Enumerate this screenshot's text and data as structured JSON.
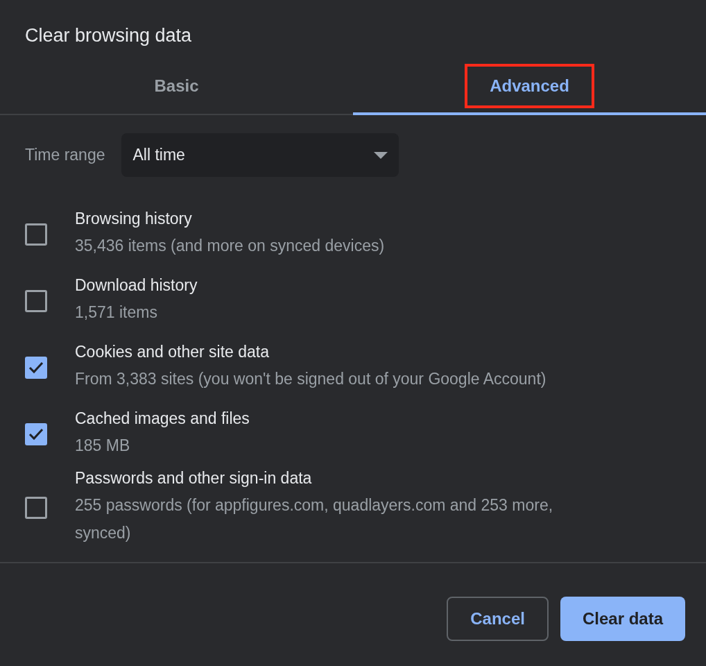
{
  "dialog": {
    "title": "Clear browsing data"
  },
  "tabs": [
    {
      "label": "Basic",
      "selected": false,
      "highlighted": false
    },
    {
      "label": "Advanced",
      "selected": true,
      "highlighted": true
    }
  ],
  "time_range": {
    "label": "Time range",
    "value": "All time"
  },
  "options": [
    {
      "title": "Browsing history",
      "detail": "35,436 items (and more on synced devices)",
      "checked": false
    },
    {
      "title": "Download history",
      "detail": "1,571 items",
      "checked": false
    },
    {
      "title": "Cookies and other site data",
      "detail": "From 3,383 sites (you won't be signed out of your Google Account)",
      "checked": true
    },
    {
      "title": "Cached images and files",
      "detail": "185 MB",
      "checked": true
    },
    {
      "title": "Passwords and other sign-in data",
      "detail": "255 passwords (for appfigures.com, quadlayers.com and 253 more, synced)",
      "checked": false
    }
  ],
  "buttons": [
    {
      "label": "Cancel",
      "kind": "secondary"
    },
    {
      "label": "Clear data",
      "kind": "primary"
    }
  ]
}
